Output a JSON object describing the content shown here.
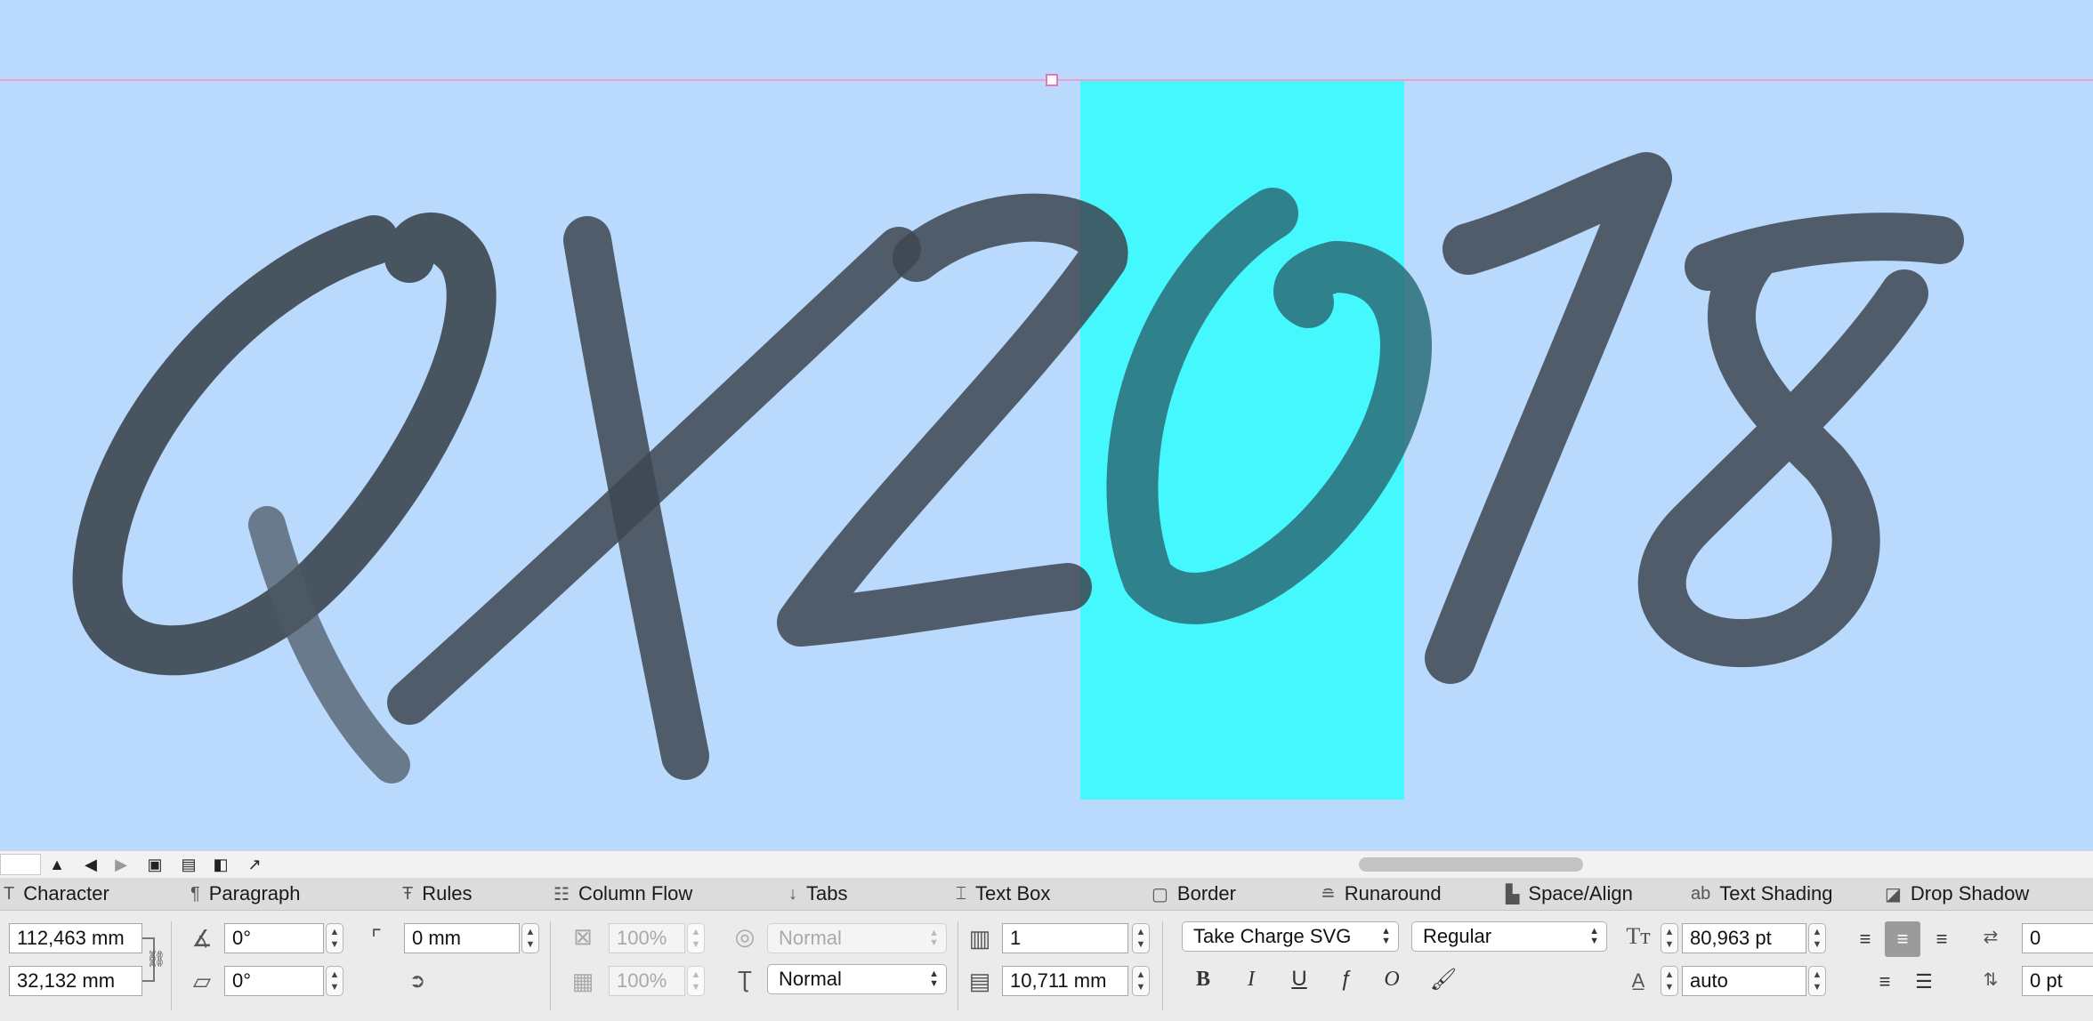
{
  "canvas": {
    "background": "#b9dafd",
    "highlight_color": "#44f8fd",
    "ink_color": "#3d4550"
  },
  "tabs": [
    {
      "label": "Character",
      "icon": "text-icon"
    },
    {
      "label": "Paragraph",
      "icon": "pilcrow-icon"
    },
    {
      "label": "Rules",
      "icon": "rules-icon"
    },
    {
      "label": "Column Flow",
      "icon": "column-flow-icon"
    },
    {
      "label": "Tabs",
      "icon": "tab-stop-icon"
    },
    {
      "label": "Text Box",
      "icon": "text-box-icon"
    },
    {
      "label": "Border",
      "icon": "border-icon"
    },
    {
      "label": "Runaround",
      "icon": "runaround-icon"
    },
    {
      "label": "Space/Align",
      "icon": "space-align-icon"
    },
    {
      "label": "Text Shading",
      "icon": "text-shading-icon"
    },
    {
      "label": "Drop Shadow",
      "icon": "drop-shadow-icon"
    }
  ],
  "panel": {
    "width": "112,463 mm",
    "height": "32,132 mm",
    "angle": "0°",
    "skew": "0°",
    "corner_radius": "0 mm",
    "fill_opacity": "100%",
    "frame_opacity": "100%",
    "blend_mode_1": "Normal",
    "blend_mode_2": "Normal",
    "columns": "1",
    "gutter": "10,711 mm",
    "font": "Take Charge SVG",
    "style": "Regular",
    "font_size": "80,963 pt",
    "leading": "auto",
    "tracking": "0",
    "baseline_shift": "0 pt"
  }
}
